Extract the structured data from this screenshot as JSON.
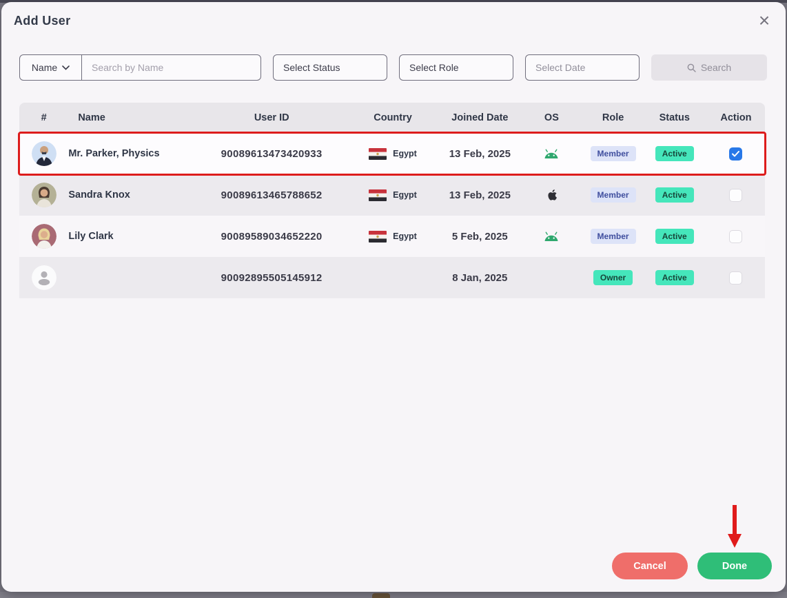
{
  "modal": {
    "title": "Add User",
    "close_glyph": "×"
  },
  "filters": {
    "name_dropdown_label": "Name",
    "search_placeholder": "Search by Name",
    "status_select_value": "Select Status",
    "role_select_value": "Select Role",
    "date_placeholder": "Select Date",
    "search_button_label": "Search"
  },
  "table": {
    "headers": [
      "#",
      "Name",
      "User ID",
      "Country",
      "Joined Date",
      "OS",
      "Role",
      "Status",
      "Action"
    ],
    "rows": [
      {
        "name": "Mr. Parker, Physics",
        "user_id": "90089613473420933",
        "country": "Egypt",
        "joined": "13 Feb, 2025",
        "os": "android",
        "role": "Member",
        "role_style": "member",
        "status": "Active",
        "checked": true,
        "highlighted": true,
        "avatar": "parker"
      },
      {
        "name": "Sandra Knox",
        "user_id": "90089613465788652",
        "country": "Egypt",
        "joined": "13 Feb, 2025",
        "os": "apple",
        "role": "Member",
        "role_style": "member",
        "status": "Active",
        "checked": false,
        "highlighted": false,
        "avatar": "sandra"
      },
      {
        "name": "Lily Clark",
        "user_id": "90089589034652220",
        "country": "Egypt",
        "joined": "5 Feb, 2025",
        "os": "android",
        "role": "Member",
        "role_style": "member",
        "status": "Active",
        "checked": false,
        "highlighted": false,
        "avatar": "lily"
      },
      {
        "name": "",
        "user_id": "90092895505145912",
        "country": "",
        "joined": "8 Jan, 2025",
        "os": "",
        "role": "Owner",
        "role_style": "owner",
        "status": "Active",
        "checked": false,
        "highlighted": false,
        "avatar": "placeholder"
      }
    ]
  },
  "footer": {
    "cancel_label": "Cancel",
    "done_label": "Done"
  },
  "colors": {
    "highlight_border": "#dd1c1c",
    "cancel_button": "#ef6e6a",
    "done_button": "#2fbe78",
    "member_badge_bg": "#dde3f8",
    "member_badge_text": "#3f4e9e",
    "active_badge_bg": "#45e6bb",
    "checkbox_checked": "#2878e8",
    "android_green": "#2fa86e",
    "arrow_red": "#e01b1b"
  }
}
